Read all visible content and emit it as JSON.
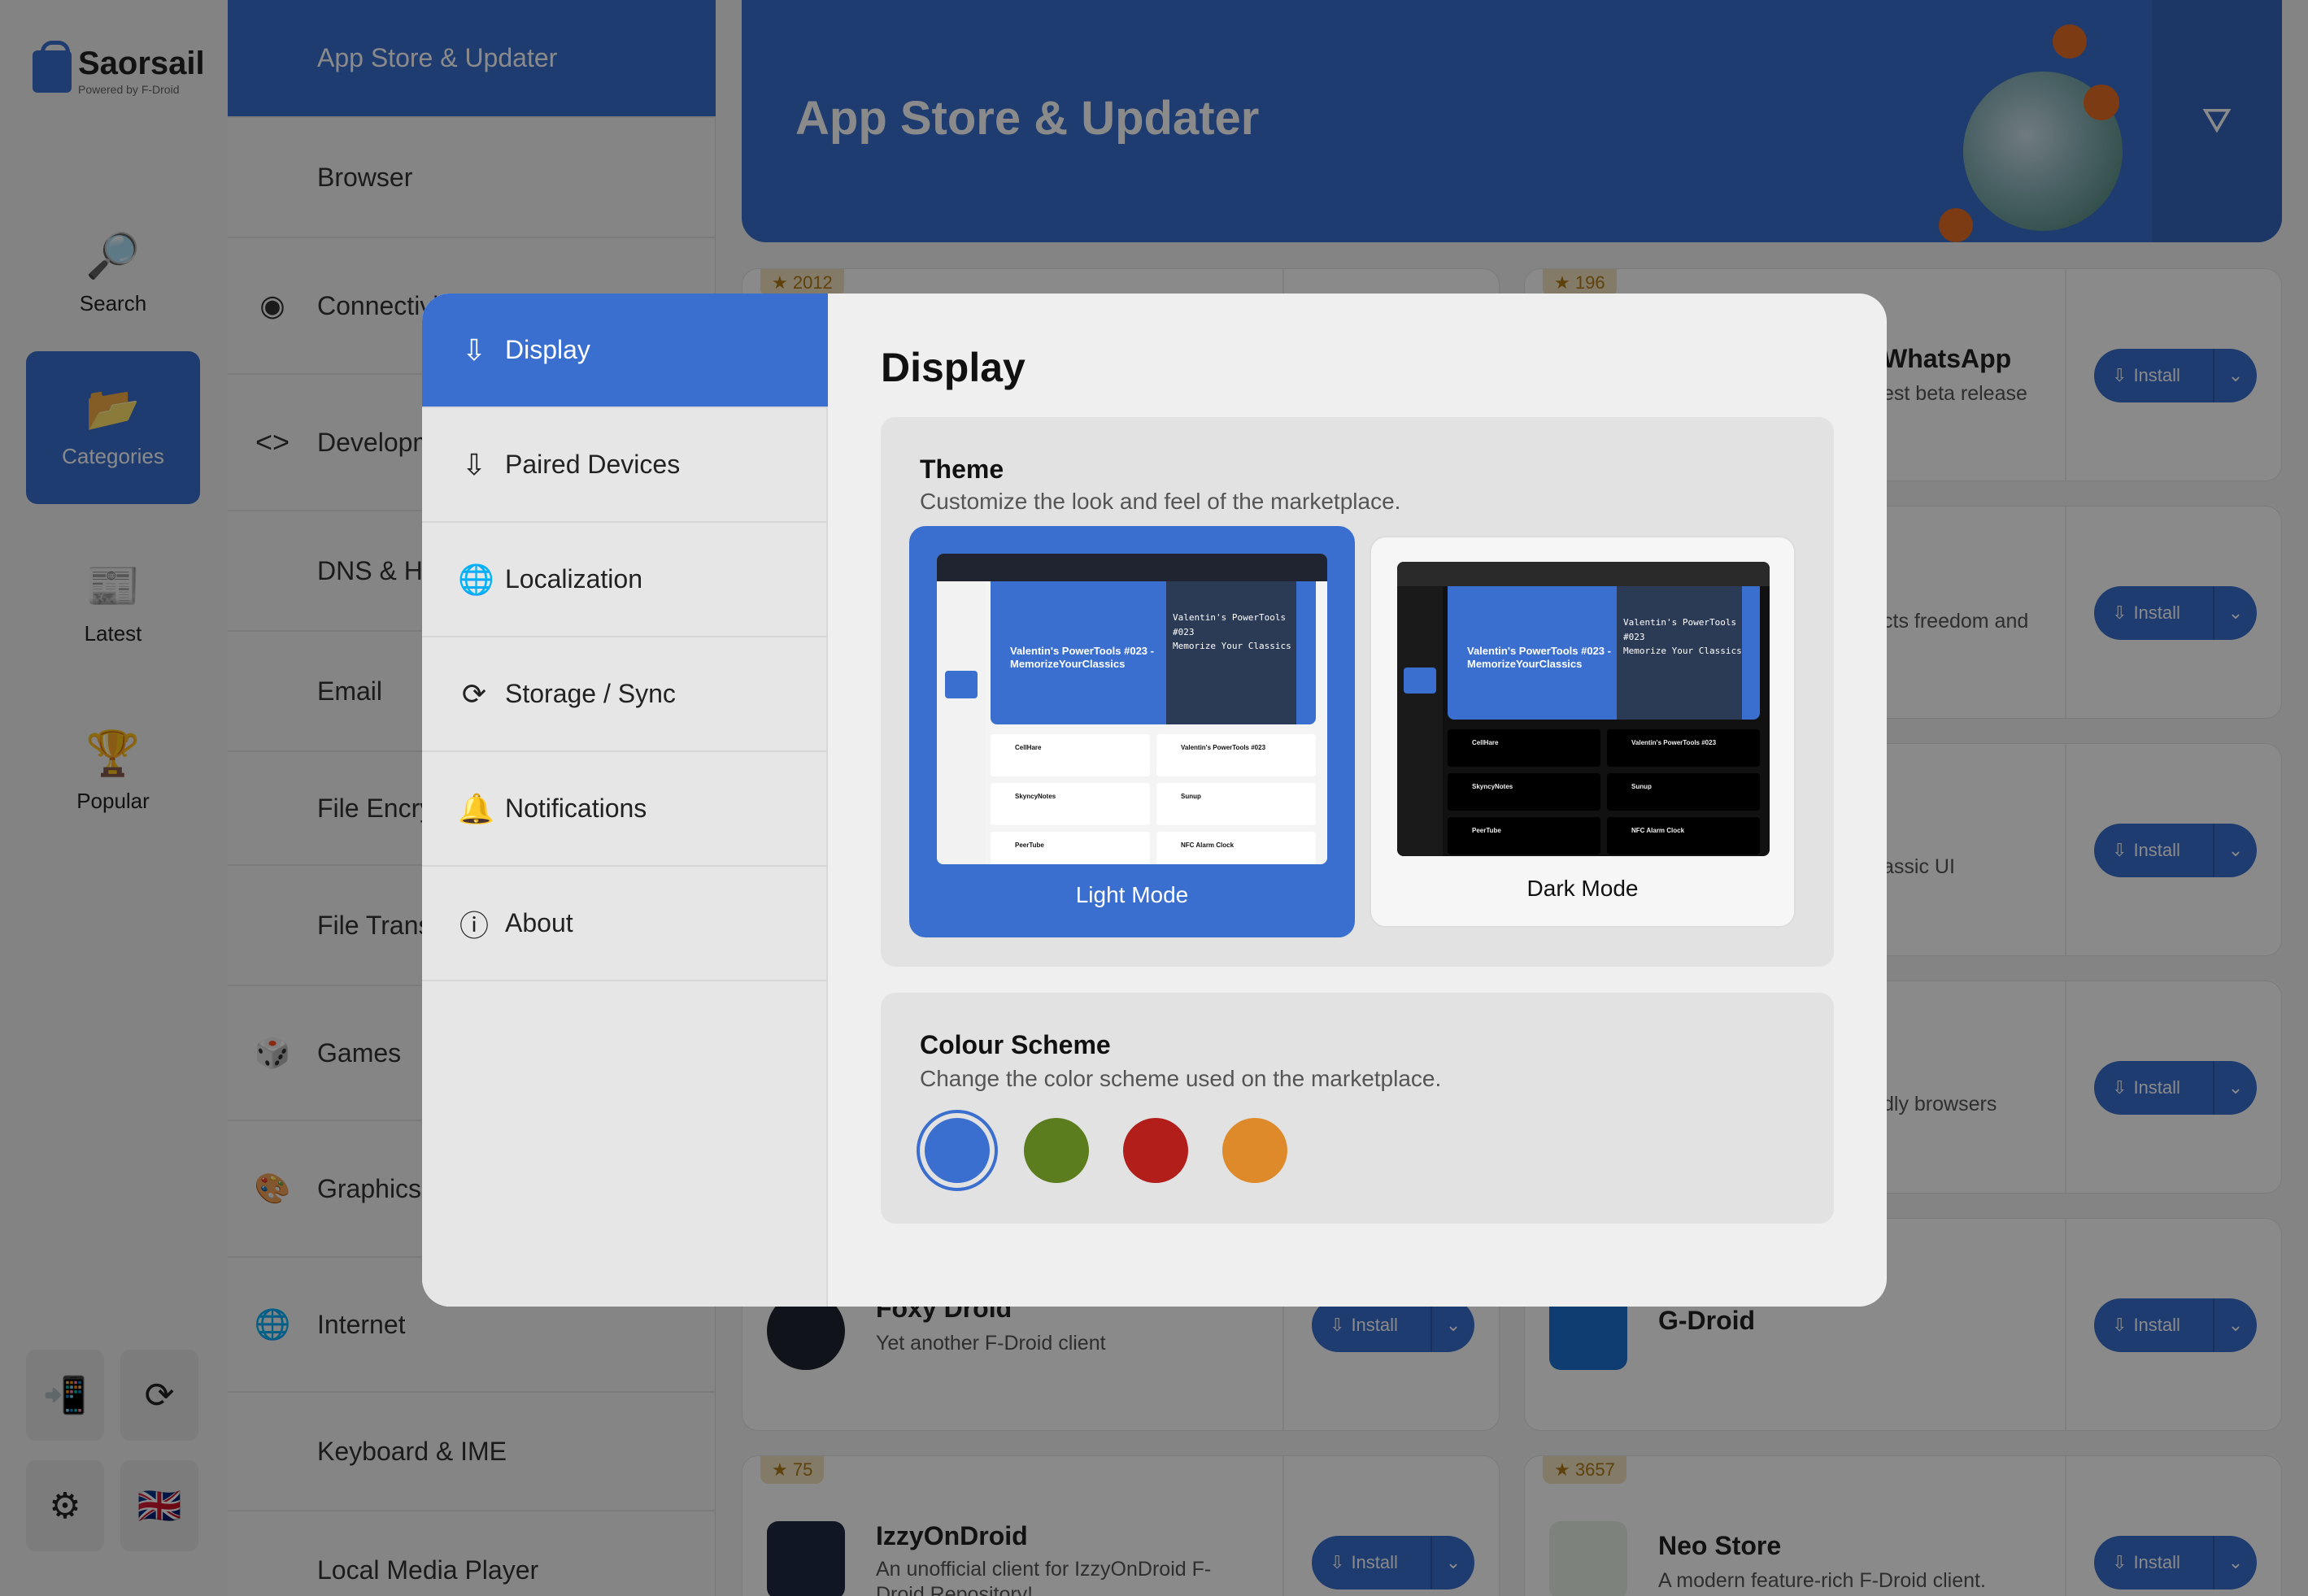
{
  "app": {
    "name": "Saorsail",
    "tagline": "Powered by F-Droid"
  },
  "rail": {
    "items": [
      {
        "label": "Search",
        "icon": "magnifier-icon"
      },
      {
        "label": "Categories",
        "icon": "folder-icon",
        "active": true
      },
      {
        "label": "Latest",
        "icon": "newspaper-icon"
      },
      {
        "label": "Popular",
        "icon": "trophy-icon"
      }
    ],
    "bottom_buttons": [
      "install-device-icon",
      "sync-icon",
      "settings-icon",
      "flag-icon"
    ]
  },
  "categories": [
    {
      "label": "App Store & Updater",
      "active": true
    },
    {
      "label": "Browser"
    },
    {
      "label": "Connectivity"
    },
    {
      "label": "Development"
    },
    {
      "label": "DNS & Hosts"
    },
    {
      "label": "Email"
    },
    {
      "label": "File Encryption & Vault"
    },
    {
      "label": "File Transfer"
    },
    {
      "label": "Games"
    },
    {
      "label": "Graphics"
    },
    {
      "label": "Internet"
    },
    {
      "label": "Keyboard & IME"
    },
    {
      "label": "Local Media Player"
    }
  ],
  "hero": {
    "title": "App Store & Updater"
  },
  "cards": [
    {
      "stars": "2012",
      "name": "",
      "desc": ""
    },
    {
      "stars": "196",
      "name": "WhatsApp",
      "desc": "est beta release"
    },
    {
      "stars": "",
      "name": "",
      "desc": "cts freedom and"
    },
    {
      "stars": "",
      "name": "",
      "desc": "assic UI"
    },
    {
      "stars": "",
      "name": "",
      "desc": "dly browsers"
    },
    {
      "stars": "",
      "name": "Foxy Droid",
      "desc": "Yet another F-Droid client"
    },
    {
      "stars": "",
      "name": "G-Droid",
      "desc": ""
    },
    {
      "stars": "75",
      "name": "IzzyOnDroid",
      "desc": "An unofficial client for IzzyOnDroid F-Droid Repository!"
    },
    {
      "stars": "3657",
      "name": "Neo Store",
      "desc": "A modern feature-rich F-Droid client."
    }
  ],
  "install_label": "Install",
  "modal": {
    "nav": [
      {
        "label": "Display",
        "icon": "display-icon",
        "active": true
      },
      {
        "label": "Paired Devices",
        "icon": "device-icon"
      },
      {
        "label": "Localization",
        "icon": "globe-icon"
      },
      {
        "label": "Storage / Sync",
        "icon": "sync-icon"
      },
      {
        "label": "Notifications",
        "icon": "bell-icon"
      },
      {
        "label": "About",
        "icon": "info-icon"
      }
    ],
    "title": "Display",
    "theme": {
      "title": "Theme",
      "desc": "Customize the look and feel of the marketplace.",
      "options": [
        {
          "label": "Light Mode",
          "selected": true
        },
        {
          "label": "Dark Mode",
          "selected": false
        }
      ],
      "preview": {
        "banner": "Valentin's PowerTools #023 - MemorizeYourClassics",
        "code_title": "Valentin's PowerTools #023",
        "code_sub": "Memorize Your Classics",
        "rows": [
          "CellHare",
          "Valentin's PowerTools #023",
          "SkyncyNotes",
          "Sunup",
          "PeerTube",
          "NFC Alarm Clock"
        ]
      }
    },
    "colour_scheme": {
      "title": "Colour Scheme",
      "desc": "Change the color scheme used on the marketplace.",
      "swatches": [
        "#3a6fcf",
        "#5b7d1e",
        "#b21e1a",
        "#de8a2a"
      ],
      "selected_index": 0
    }
  }
}
